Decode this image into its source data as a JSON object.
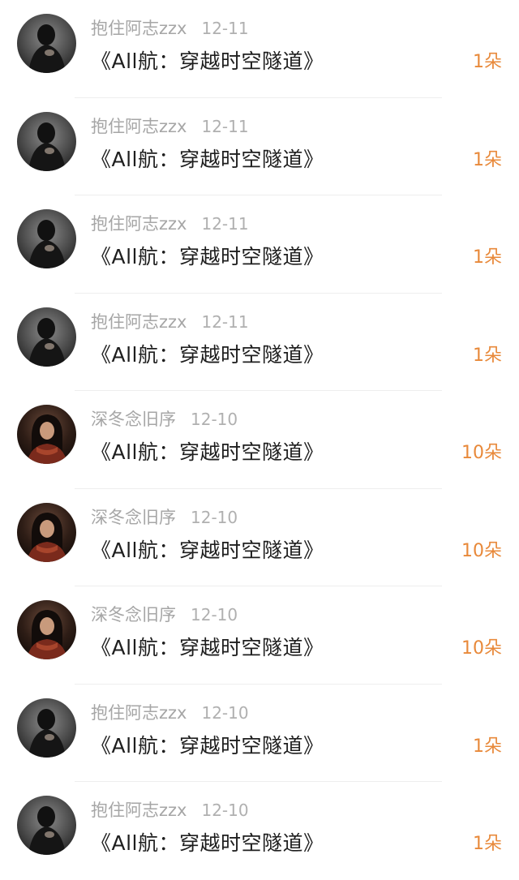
{
  "colors": {
    "username": "#a6a6a6",
    "title": "#1e1e1e",
    "gift_count": "#e8893a",
    "separator": "#eeeeee"
  },
  "avatars": {
    "user_a": "dark-figure-avatar",
    "user_b": "girl-red-scarf-avatar"
  },
  "records": [
    {
      "user": "抱住阿志zzx",
      "date": "12-11",
      "title": "《All航：穿越时空隧道》",
      "gift": "1朵",
      "avatar": "user_a"
    },
    {
      "user": "抱住阿志zzx",
      "date": "12-11",
      "title": "《All航：穿越时空隧道》",
      "gift": "1朵",
      "avatar": "user_a"
    },
    {
      "user": "抱住阿志zzx",
      "date": "12-11",
      "title": "《All航：穿越时空隧道》",
      "gift": "1朵",
      "avatar": "user_a"
    },
    {
      "user": "抱住阿志zzx",
      "date": "12-11",
      "title": "《All航：穿越时空隧道》",
      "gift": "1朵",
      "avatar": "user_a"
    },
    {
      "user": "深冬念旧序",
      "date": "12-10",
      "title": "《All航：穿越时空隧道》",
      "gift": "10朵",
      "avatar": "user_b"
    },
    {
      "user": "深冬念旧序",
      "date": "12-10",
      "title": "《All航：穿越时空隧道》",
      "gift": "10朵",
      "avatar": "user_b"
    },
    {
      "user": "深冬念旧序",
      "date": "12-10",
      "title": "《All航：穿越时空隧道》",
      "gift": "10朵",
      "avatar": "user_b"
    },
    {
      "user": "抱住阿志zzx",
      "date": "12-10",
      "title": "《All航：穿越时空隧道》",
      "gift": "1朵",
      "avatar": "user_a"
    },
    {
      "user": "抱住阿志zzx",
      "date": "12-10",
      "title": "《All航：穿越时空隧道》",
      "gift": "1朵",
      "avatar": "user_a"
    }
  ]
}
